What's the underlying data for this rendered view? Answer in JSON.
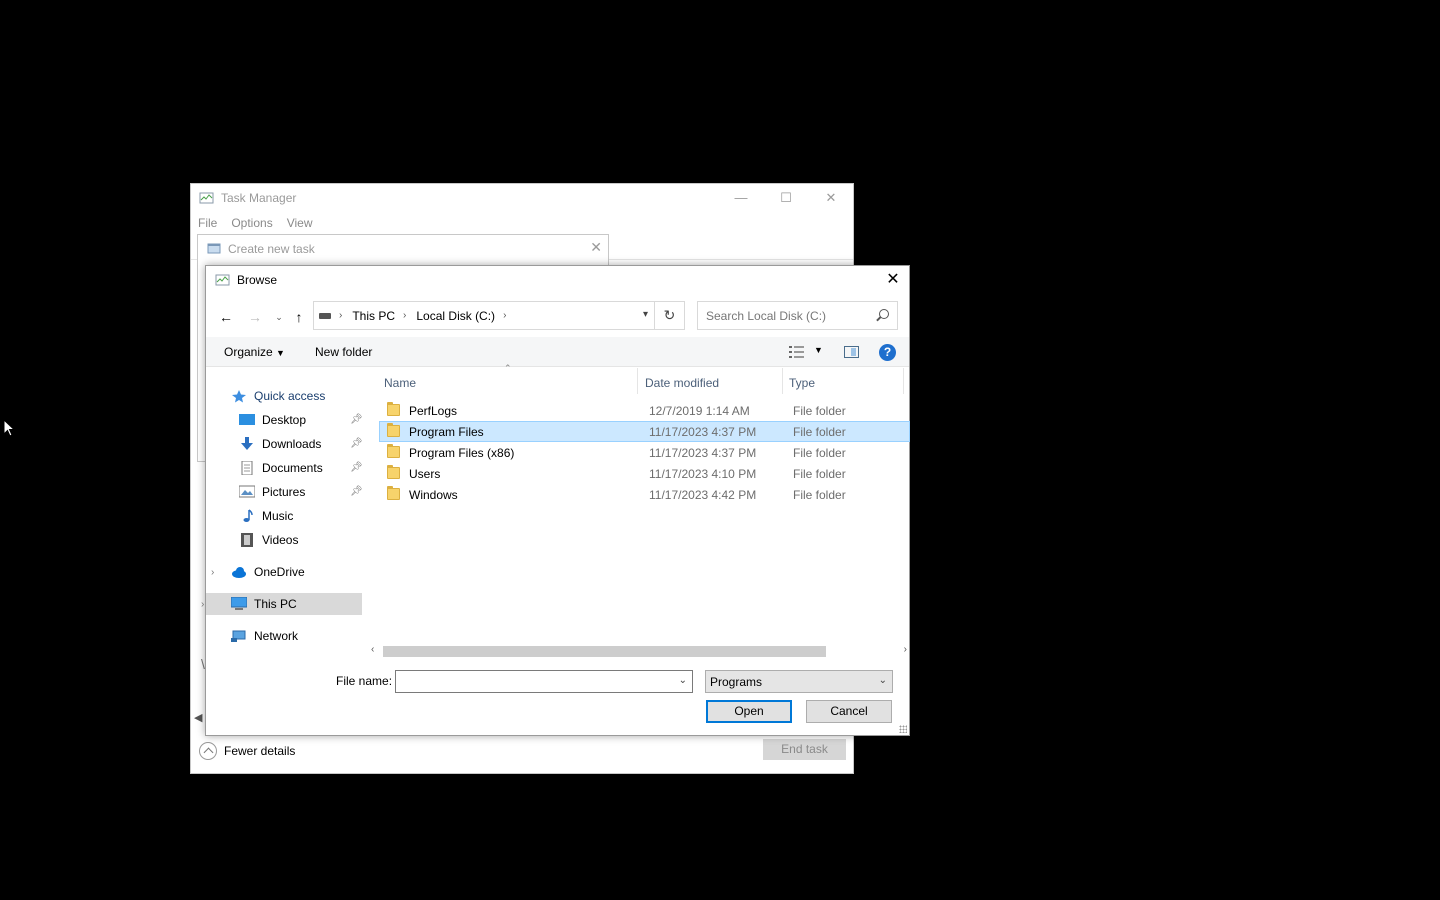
{
  "task_manager": {
    "title": "Task Manager",
    "menu": [
      "File",
      "Options",
      "View"
    ],
    "fewer_details": "Fewer details",
    "end_task": "End task"
  },
  "create_task": {
    "title": "Create new task"
  },
  "browse": {
    "title": "Browse",
    "breadcrumb": [
      "This PC",
      "Local Disk (C:)"
    ],
    "search_placeholder": "Search Local Disk (C:)",
    "toolbar": {
      "organize": "Organize",
      "new_folder": "New folder"
    },
    "nav": {
      "quick_access": "Quick access",
      "desktop": "Desktop",
      "downloads": "Downloads",
      "documents": "Documents",
      "pictures": "Pictures",
      "music": "Music",
      "videos": "Videos",
      "onedrive": "OneDrive",
      "this_pc": "This PC",
      "network": "Network"
    },
    "columns": {
      "name": "Name",
      "date": "Date modified",
      "type": "Type"
    },
    "files": [
      {
        "name": "PerfLogs",
        "date": "12/7/2019 1:14 AM",
        "type": "File folder"
      },
      {
        "name": "Program Files",
        "date": "11/17/2023 4:37 PM",
        "type": "File folder"
      },
      {
        "name": "Program Files (x86)",
        "date": "11/17/2023 4:37 PM",
        "type": "File folder"
      },
      {
        "name": "Users",
        "date": "11/17/2023 4:10 PM",
        "type": "File folder"
      },
      {
        "name": "Windows",
        "date": "11/17/2023 4:42 PM",
        "type": "File folder"
      }
    ],
    "file_name_label": "File name:",
    "file_name_value": "",
    "filter": "Programs",
    "open": "Open",
    "cancel": "Cancel"
  },
  "colors": {
    "selection": "#cce8ff",
    "accent": "#0078d7"
  }
}
